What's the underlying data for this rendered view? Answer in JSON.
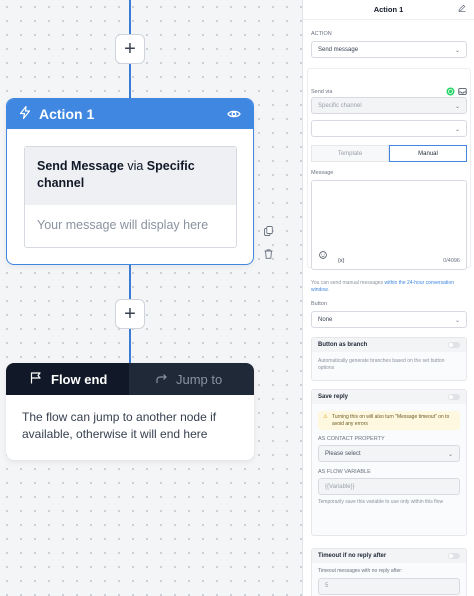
{
  "canvas": {
    "action_card": {
      "title": "Action 1",
      "message_strong1": "Send Message",
      "message_via": " via ",
      "message_strong2": "Specific channel",
      "placeholder": "Your message will display here"
    },
    "flow_end": {
      "tab_end": "Flow end",
      "tab_jump": "Jump to",
      "description": "The flow can jump to another node if available, otherwise it will end here"
    }
  },
  "panel": {
    "title": "Action 1",
    "action_label": "ACTION",
    "action_value": "Send message",
    "send_via_label": "Send via",
    "channel_value": "Specific channel",
    "second_select": "",
    "tabs": [
      "Template",
      "Manual"
    ],
    "active_tab": "Manual",
    "message_label": "Message",
    "char_count": "0/4096",
    "variable_btn": "{x}",
    "manual_note_prefix": "You can send manual messages ",
    "manual_note_link": "within the 24-hour conversation window.",
    "button_label": "Button",
    "button_value": "None",
    "branch_title": "Button as branch",
    "branch_desc": "Automatically generate branches based on the set button options",
    "save_title": "Save reply",
    "save_warning": "Turning this on will also turn \"Message timeout\" on to avoid any errors",
    "contact_prop_label": "AS CONTACT PROPERTY",
    "contact_prop_value": "Please select",
    "flow_var_label": "AS FLOW VARIABLE",
    "flow_var_placeholder": "{{Variable}}",
    "flow_var_desc": "Temporarily save this variable to use only within this flow",
    "timeout_title": "Timeout if no reply after",
    "timeout_desc": "Timeout messages with no reply after:",
    "timeout_value": "5"
  },
  "colors": {
    "accent": "#3f87e0",
    "dark_header": "#111827",
    "whatsapp": "#25d366"
  }
}
